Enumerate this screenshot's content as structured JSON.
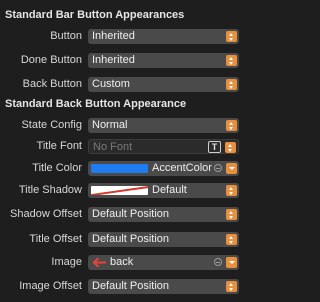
{
  "sections": {
    "bar_buttons": "Standard Bar Button Appearances",
    "back_button": "Standard Back Button Appearance"
  },
  "rows": {
    "button": {
      "label": "Button",
      "value": "Inherited"
    },
    "done_button": {
      "label": "Done Button",
      "value": "Inherited"
    },
    "back_button": {
      "label": "Back Button",
      "value": "Custom"
    },
    "state_config": {
      "label": "State Config",
      "value": "Normal"
    },
    "title_font": {
      "label": "Title Font",
      "placeholder": "No Font",
      "font_button": "T"
    },
    "title_color": {
      "label": "Title Color",
      "value": "AccentColor",
      "swatch_color": "#1f7cf0"
    },
    "title_shadow": {
      "label": "Title Shadow",
      "value": "Default"
    },
    "shadow_offset": {
      "label": "Shadow Offset",
      "value": "Default Position"
    },
    "title_offset": {
      "label": "Title Offset",
      "value": "Default Position"
    },
    "image": {
      "label": "Image",
      "value": "back",
      "icon": "back-arrow-icon"
    },
    "image_offset": {
      "label": "Image Offset",
      "value": "Default Position"
    }
  },
  "colors": {
    "background": "#1e1e1e",
    "control": "#4a4a4a",
    "accent": "#e8903d"
  }
}
